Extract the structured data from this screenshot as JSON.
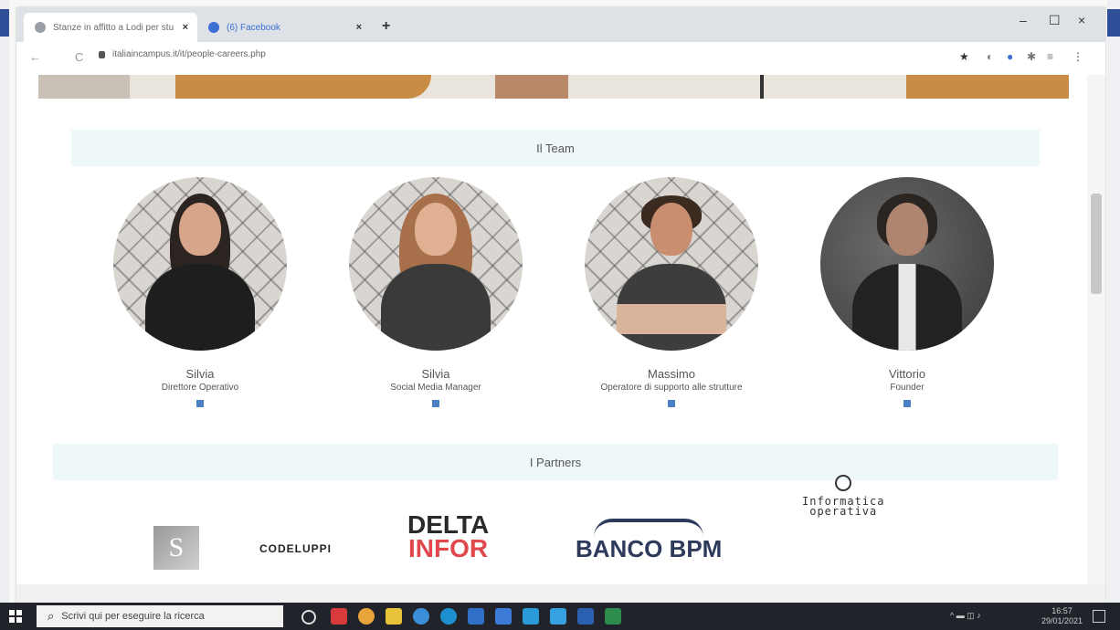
{
  "browser": {
    "tabs": [
      {
        "title": "Stanze in affitto a Lodi per stud",
        "close": "×"
      },
      {
        "title": "(6) Facebook",
        "close": "×"
      }
    ],
    "new_tab": "+",
    "url": "italiaincampus.it/it/people-careers.php",
    "window_controls": {
      "minimize": "–",
      "maximize": "☐",
      "close": "×"
    }
  },
  "team_section": {
    "title": "Il Team",
    "members": [
      {
        "name": "Silvia",
        "role": "Direttore Operativo"
      },
      {
        "name": "Silvia",
        "role": "Social Media Manager"
      },
      {
        "name": "Massimo",
        "role": "Operatore di supporto alle strutture"
      },
      {
        "name": "Vittorio",
        "role": "Founder"
      }
    ]
  },
  "partners_section": {
    "title": "I Partners",
    "logos": {
      "codeluppi": "CODELUPPI",
      "delta_top": "DELTA",
      "delta_bottom": "INFOR",
      "banco": "BANCO BPM",
      "informatica_top": "Informatica",
      "informatica_bottom": "operativa"
    }
  },
  "taskbar": {
    "search_placeholder": "Scrivi qui per eseguire la ricerca",
    "time": "16:57",
    "date": "29/01/2021"
  },
  "colors": {
    "accent": "#4a7fc1",
    "section_bg": "#eef7f9",
    "delta_red": "#e0484e",
    "banco_blue": "#2e3a5c"
  }
}
